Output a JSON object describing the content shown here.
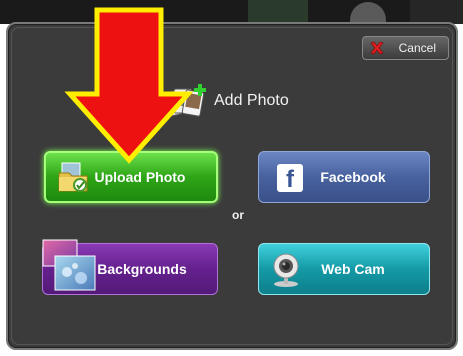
{
  "dialog": {
    "title": "Add Photo",
    "cancel_label": "Cancel",
    "separator": "or",
    "buttons": {
      "upload": "Upload Photo",
      "facebook": "Facebook",
      "backgrounds": "Backgrounds",
      "webcam": "Web Cam"
    }
  },
  "icons": {
    "cancel": "close-x-icon",
    "title": "photos-add-icon",
    "upload": "folder-photo-icon",
    "facebook": "facebook-f-icon",
    "backgrounds": "backgrounds-thumbnail-icon",
    "webcam": "webcam-icon",
    "annotation": "red-down-arrow"
  },
  "colors": {
    "upload_green": "#2ea517",
    "facebook_blue": "#48629f",
    "backgrounds_purple": "#65218e",
    "webcam_teal": "#149aa6",
    "arrow_red": "#ee1111",
    "arrow_outline": "#ffee00"
  }
}
